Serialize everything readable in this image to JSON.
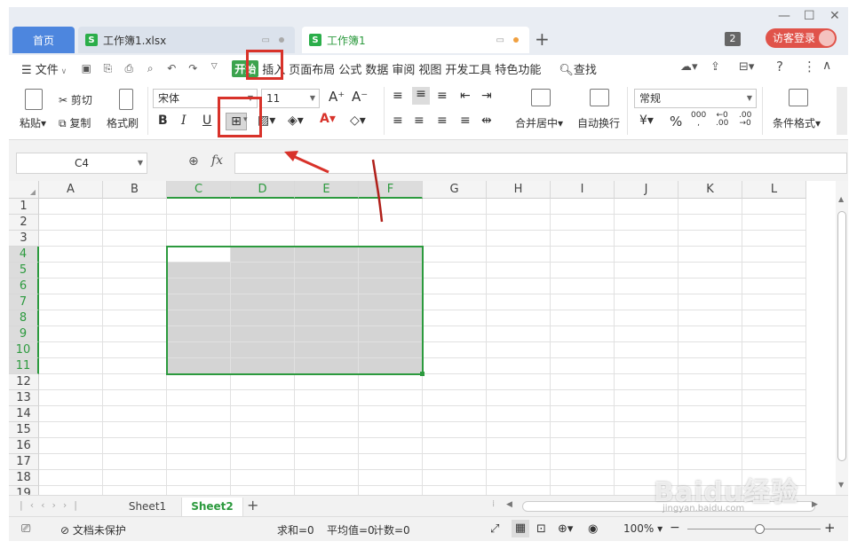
{
  "titlebar": {
    "tabs": [
      {
        "label": "首页"
      },
      {
        "label": "工作簿1.xlsx"
      },
      {
        "label": "工作簿1"
      }
    ],
    "window_count": "2",
    "login_label": "访客登录"
  },
  "menu": {
    "file_label": "文件",
    "tabs": [
      "开始",
      "插入",
      "页面布局",
      "公式",
      "数据",
      "审阅",
      "视图",
      "开发工具",
      "特色功能"
    ],
    "search_label": "查找"
  },
  "ribbon": {
    "paste": "粘贴",
    "cut": "剪切",
    "copy": "复制",
    "format_painter": "格式刷",
    "font_name": "宋体",
    "font_size": "11",
    "bold": "B",
    "italic": "I",
    "underline": "U",
    "merge_center": "合并居中",
    "wrap_text": "自动换行",
    "number_format": "常规",
    "percent": "%",
    "conditional_format": "条件格式"
  },
  "formula": {
    "name_box": "C4",
    "fx_label": "fx",
    "value": ""
  },
  "grid": {
    "columns": [
      "A",
      "B",
      "C",
      "D",
      "E",
      "F",
      "G",
      "H",
      "I",
      "J",
      "K",
      "L"
    ],
    "rows": [
      "1",
      "2",
      "3",
      "4",
      "5",
      "6",
      "7",
      "8",
      "9",
      "10",
      "11",
      "12",
      "13",
      "14",
      "15",
      "16",
      "17",
      "18",
      "19"
    ],
    "selection": "C4:F11",
    "active_cell": "C4"
  },
  "sheets": {
    "tabs": [
      "Sheet1",
      "Sheet2"
    ],
    "active": "Sheet2"
  },
  "status": {
    "protect": "文档未保护",
    "sum": "求和=0",
    "average": "平均值=0",
    "count": "计数=0",
    "zoom": "100%"
  },
  "watermark": {
    "text": "Baidu经验",
    "sub": "jingyan.baidu.com"
  },
  "colors": {
    "accent_green": "#2c9a3e",
    "highlight_red": "#d8322a",
    "home_tab_blue": "#4d86de"
  }
}
